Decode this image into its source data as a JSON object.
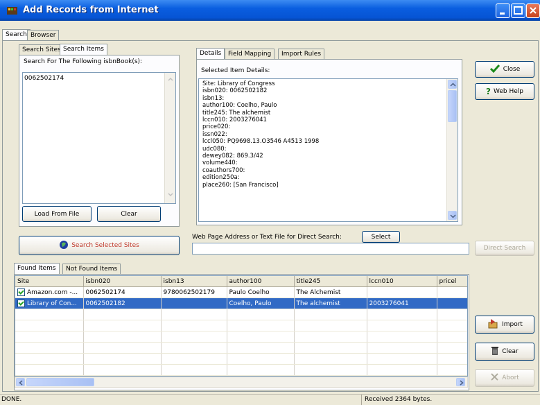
{
  "window": {
    "title": "Add Records from Internet"
  },
  "main_tabs": [
    {
      "label": "Search"
    },
    {
      "label": "Browser"
    }
  ],
  "left_tabs": [
    {
      "label": "Search Sites"
    },
    {
      "label": "Search Items"
    }
  ],
  "search_items": {
    "label": "Search For The Following isbnBook(s):",
    "lines": [
      "0062502174"
    ]
  },
  "buttons": {
    "load_from_file": "Load From File",
    "clear_left": "Clear",
    "search_selected_sites": "Search Selected Sites",
    "select": "Select",
    "direct_search": "Direct Search",
    "close": "Close",
    "web_help": "Web Help",
    "import": "Import",
    "clear_right": "Clear",
    "abort": "Abort"
  },
  "detail_tabs": [
    {
      "label": "Details"
    },
    {
      "label": "Field Mapping"
    },
    {
      "label": "Import Rules"
    }
  ],
  "selected_item": {
    "label": "Selected Item Details:",
    "text": "Site: Library of Congress\nisbn020: 0062502182\nisbn13:\nauthor100: Coelho, Paulo\ntitle245: The alchemist\nlccn010: 2003276041\nprice020:\nissn022:\nlccl050: PQ9698.13.O3546 A4513 1998\nudc080:\ndewey082: 869.3/42\nvolume440:\ncoauthors700:\nedition250a:\nplace260: [San Francisco]"
  },
  "direct": {
    "label": "Web Page Address or Text File for Direct Search:",
    "value": ""
  },
  "result_tabs": [
    {
      "label": "Found Items"
    },
    {
      "label": "Not Found Items"
    }
  ],
  "results": {
    "columns": [
      "Site",
      "isbn020",
      "isbn13",
      "author100",
      "title245",
      "lccn010",
      "pricel"
    ],
    "rows": [
      {
        "site": "Amazon.com -...",
        "isbn020": "0062502174",
        "isbn13": "9780062502179",
        "author100": "Paulo Coelho",
        "title245": "The Alchemist",
        "lccn010": "",
        "price": "",
        "checked": true,
        "selected": false
      },
      {
        "site": "Library of Con...",
        "isbn020": "0062502182",
        "isbn13": "",
        "author100": "Coelho, Paulo",
        "title245": "The alchemist",
        "lccn010": "2003276041",
        "price": "",
        "checked": true,
        "selected": true
      }
    ]
  },
  "status": {
    "left": "DONE.",
    "right": "Received 2364 bytes."
  },
  "icons": {
    "app": "film-icon",
    "search": "globe-icon",
    "close": "checkmark-icon",
    "help": "question-icon",
    "import": "import-icon",
    "clear": "trash-icon",
    "abort": "abort-icon"
  },
  "colors": {
    "titlebar": "#0a5ee0",
    "selection": "#316ac5",
    "search_text": "#c0392b"
  }
}
